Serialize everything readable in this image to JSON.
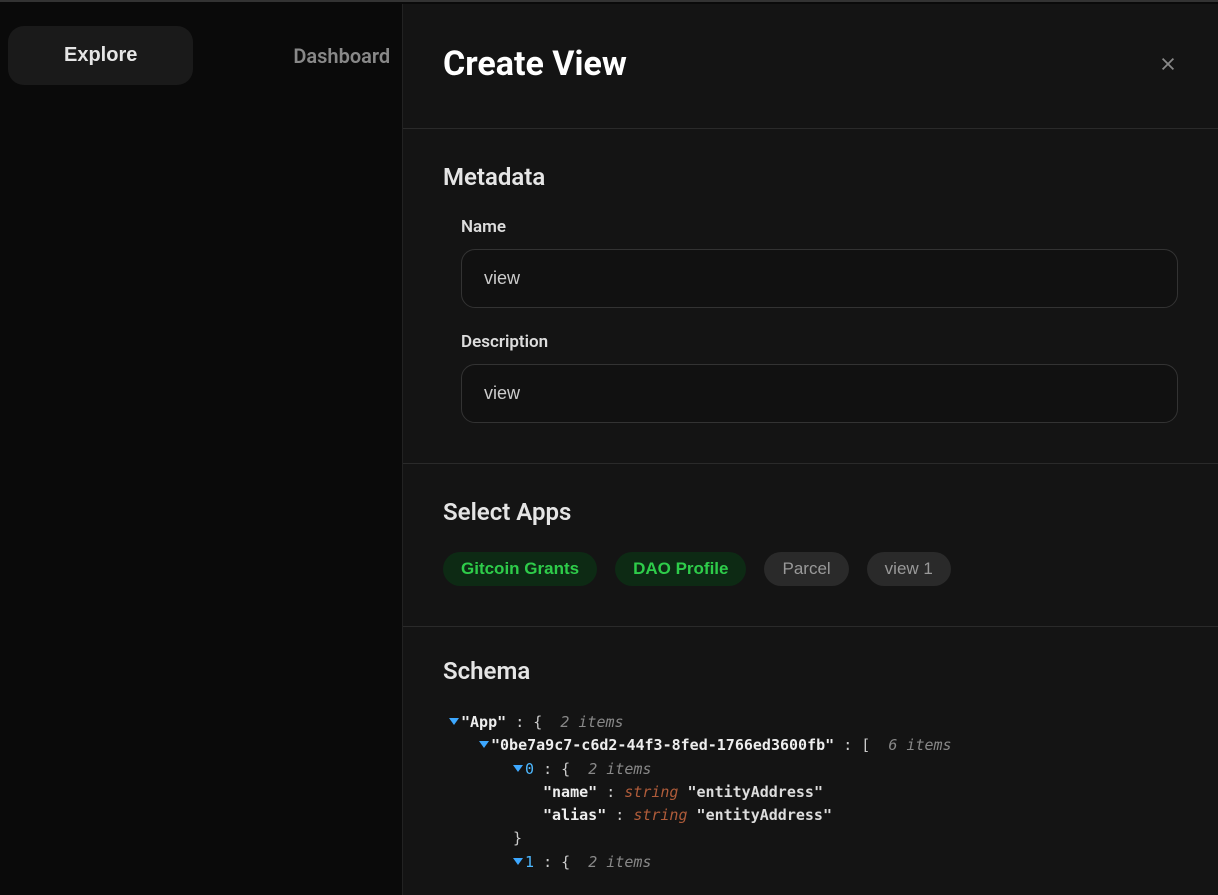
{
  "nav": {
    "explore": "Explore",
    "dashboard": "Dashboard"
  },
  "panel": {
    "title": "Create View"
  },
  "metadata": {
    "heading": "Metadata",
    "name_label": "Name",
    "name_value": "view",
    "desc_label": "Description",
    "desc_value": "view"
  },
  "apps": {
    "heading": "Select Apps",
    "items": [
      {
        "label": "Gitcoin Grants",
        "selected": true
      },
      {
        "label": "DAO Profile",
        "selected": true
      },
      {
        "label": "Parcel",
        "selected": false
      },
      {
        "label": "view 1",
        "selected": false
      }
    ]
  },
  "schema": {
    "heading": "Schema",
    "root_key": "App",
    "root_count": "2 items",
    "uuid_key": "0be7a9c7-c6d2-44f3-8fed-1766ed3600fb",
    "uuid_count": "6 items",
    "item0_idx": "0",
    "item0_count": "2 items",
    "item0_name_key": "name",
    "item0_name_type": "string",
    "item0_name_val": "entityAddress",
    "item0_alias_key": "alias",
    "item0_alias_type": "string",
    "item0_alias_val": "entityAddress",
    "close_brace": "}",
    "item1_idx": "1",
    "item1_count": "2 items"
  }
}
